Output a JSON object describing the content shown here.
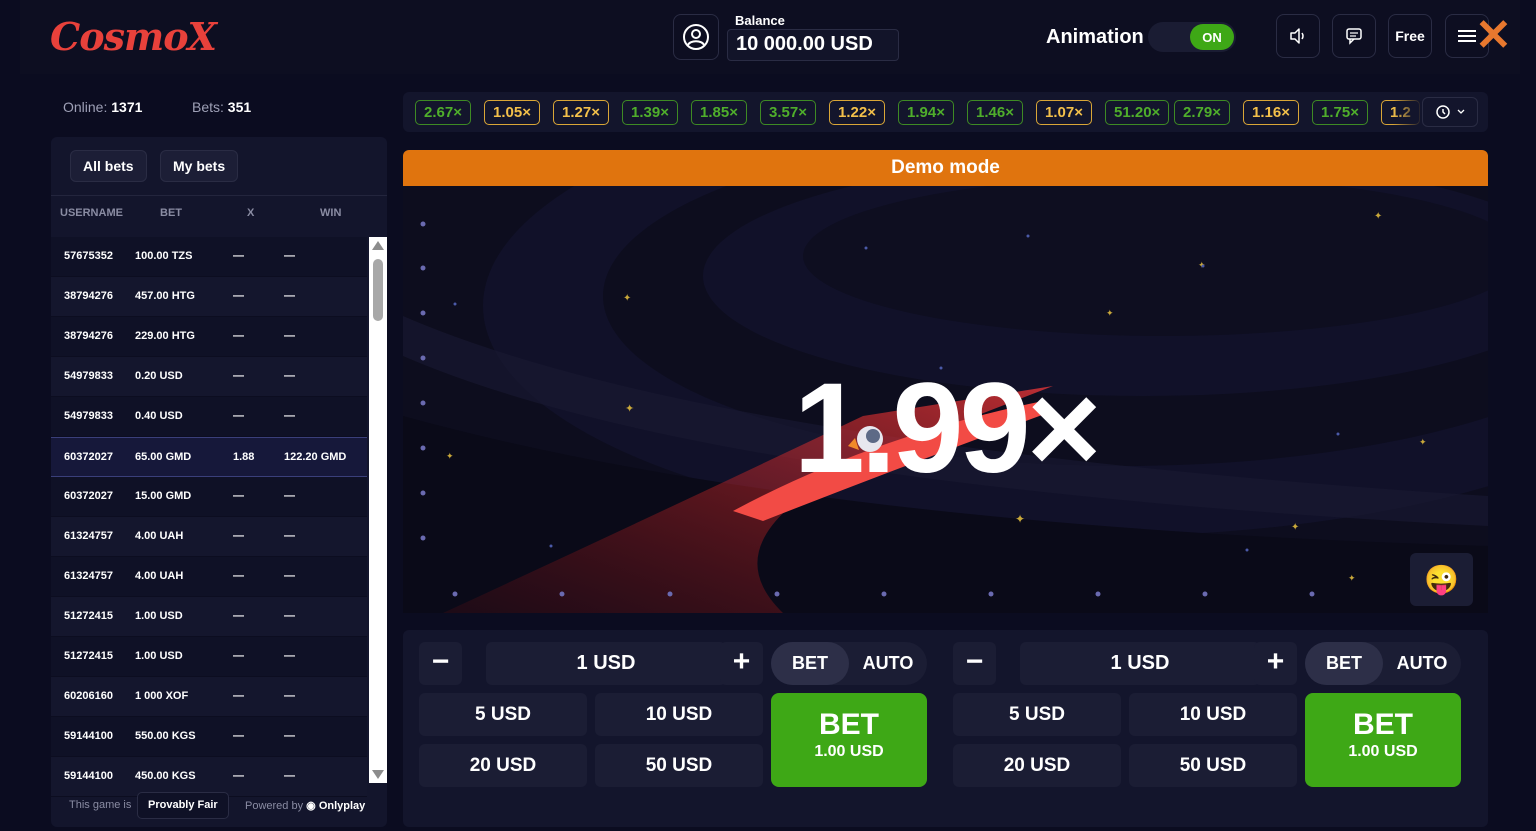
{
  "header": {
    "logo": "CosmoX",
    "balance_label": "Balance",
    "balance_value": "10 000.00 USD",
    "animation_label": "Animation",
    "animation_state": "ON",
    "free_label": "Free",
    "icons": [
      "user-icon",
      "sound-icon",
      "chat-icon",
      "menu-icon",
      "close-icon"
    ]
  },
  "stats": {
    "online_label": "Online:",
    "online_value": "1371",
    "bets_label": "Bets:",
    "bets_value": "351"
  },
  "bets_panel": {
    "tabs": [
      "All bets",
      "My bets"
    ],
    "columns": [
      "USERNAME",
      "BET",
      "X",
      "WIN"
    ],
    "rows": [
      {
        "user": "57675352",
        "bet": "100.00 TZS",
        "x": "—",
        "win": "—"
      },
      {
        "user": "38794276",
        "bet": "457.00 HTG",
        "x": "—",
        "win": "—"
      },
      {
        "user": "38794276",
        "bet": "229.00 HTG",
        "x": "—",
        "win": "—"
      },
      {
        "user": "54979833",
        "bet": "0.20 USD",
        "x": "—",
        "win": "—"
      },
      {
        "user": "54979833",
        "bet": "0.40 USD",
        "x": "—",
        "win": "—"
      },
      {
        "user": "60372027",
        "bet": "65.00 GMD",
        "x": "1.88",
        "win": "122.20 GMD"
      },
      {
        "user": "60372027",
        "bet": "15.00 GMD",
        "x": "—",
        "win": "—"
      },
      {
        "user": "61324757",
        "bet": "4.00 UAH",
        "x": "—",
        "win": "—"
      },
      {
        "user": "61324757",
        "bet": "4.00 UAH",
        "x": "—",
        "win": "—"
      },
      {
        "user": "51272415",
        "bet": "1.00 USD",
        "x": "—",
        "win": "—"
      },
      {
        "user": "51272415",
        "bet": "1.00 USD",
        "x": "—",
        "win": "—"
      },
      {
        "user": "60206160",
        "bet": "1 000 XOF",
        "x": "—",
        "win": "—"
      },
      {
        "user": "59144100",
        "bet": "550.00 KGS",
        "x": "—",
        "win": "—"
      },
      {
        "user": "59144100",
        "bet": "450.00 KGS",
        "x": "—",
        "win": "—"
      }
    ],
    "footer_prefix": "This game is",
    "provably_fair": "Provably Fair",
    "powered_by": "Powered by",
    "provider": "Onlyplay"
  },
  "history": [
    {
      "value": "2.67×",
      "tone": "green"
    },
    {
      "value": "1.05×",
      "tone": "gold"
    },
    {
      "value": "1.27×",
      "tone": "gold"
    },
    {
      "value": "1.39×",
      "tone": "green"
    },
    {
      "value": "1.85×",
      "tone": "green"
    },
    {
      "value": "3.57×",
      "tone": "green"
    },
    {
      "value": "1.22×",
      "tone": "gold"
    },
    {
      "value": "1.94×",
      "tone": "green"
    },
    {
      "value": "1.46×",
      "tone": "green"
    },
    {
      "value": "1.07×",
      "tone": "gold"
    },
    {
      "value": "51.20×",
      "tone": "green"
    },
    {
      "value": "2.79×",
      "tone": "green"
    },
    {
      "value": "1.16×",
      "tone": "gold"
    },
    {
      "value": "1.75×",
      "tone": "green"
    },
    {
      "value": "1.2",
      "tone": "gold"
    }
  ],
  "game": {
    "demo_label": "Demo mode",
    "multiplier": "1.99×",
    "emoji": "😜"
  },
  "bet_panels": [
    {
      "amount": "1 USD",
      "minus": "−",
      "plus": "+",
      "mode_bet": "BET",
      "mode_auto": "AUTO",
      "quick": [
        "5 USD",
        "10 USD",
        "20 USD",
        "50 USD"
      ],
      "bet_label": "BET",
      "bet_amount": "1.00 USD"
    },
    {
      "amount": "1 USD",
      "minus": "−",
      "plus": "+",
      "mode_bet": "BET",
      "mode_auto": "AUTO",
      "quick": [
        "5 USD",
        "10 USD",
        "20 USD",
        "50 USD"
      ],
      "bet_label": "BET",
      "bet_amount": "1.00 USD"
    }
  ],
  "colors": {
    "accent_green": "#3ea816",
    "demo_orange": "#e0740e",
    "logo_red": "#e8413b",
    "history_green": "#4fae2b",
    "history_gold": "#f3c04a"
  }
}
